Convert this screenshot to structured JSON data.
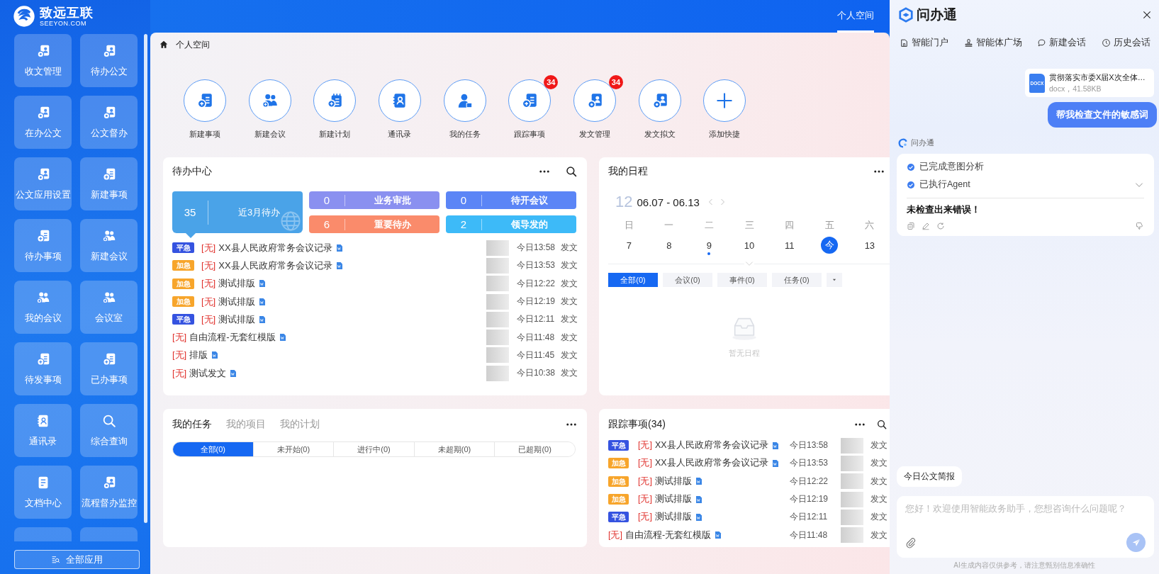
{
  "logo": {
    "name": "致远互联",
    "domain": "SEEYON.COM"
  },
  "sidebar": {
    "items": [
      {
        "kind": "app",
        "label": "收文管理"
      },
      {
        "kind": "app",
        "label": "待办公文"
      },
      {
        "kind": "app",
        "label": "在办公文"
      },
      {
        "kind": "app",
        "label": "公文督办"
      },
      {
        "kind": "app",
        "label": "公文应用设置"
      },
      {
        "kind": "app",
        "label": "新建事项"
      },
      {
        "kind": "app",
        "label": "待办事项"
      },
      {
        "kind": "app",
        "label": "新建会议"
      },
      {
        "kind": "app",
        "label": "我的会议"
      },
      {
        "kind": "app",
        "label": "会议室"
      },
      {
        "kind": "app",
        "label": "待发事项"
      },
      {
        "kind": "app",
        "label": "已办事项"
      },
      {
        "kind": "app",
        "label": "通讯录"
      },
      {
        "kind": "app",
        "label": "综合查询"
      },
      {
        "kind": "app",
        "label": "文档中心"
      },
      {
        "kind": "app",
        "label": "流程督办监控"
      },
      {
        "kind": "partial"
      },
      {
        "kind": "partial"
      }
    ],
    "all_apps_button": "全部应用"
  },
  "top_tabs": [
    {
      "label": "个人空间",
      "selected": true
    }
  ],
  "breadcrumb": "个人空间",
  "quick_actions": [
    {
      "label": "新建事项"
    },
    {
      "label": "新建会议"
    },
    {
      "label": "新建计划"
    },
    {
      "label": "通讯录"
    },
    {
      "label": "我的任务"
    },
    {
      "label": "跟踪事项",
      "badge": "34"
    },
    {
      "label": "发文管理",
      "badge": "34"
    },
    {
      "label": "发文拟文"
    },
    {
      "label": "添加快捷"
    }
  ],
  "todo": {
    "title": "待办中心",
    "stats": [
      {
        "count": "35",
        "label": "近3月待办",
        "color": "#4aa3e8"
      },
      {
        "count": "0",
        "label": "业务审批",
        "color": "#8a90f0"
      },
      {
        "count": "0",
        "label": "待开会议",
        "color": "#5b85f6"
      },
      {
        "count": "6",
        "label": "重要待办",
        "color": "#fa8b6b"
      },
      {
        "count": "2",
        "label": "领导发的",
        "color": "#3dbaf8"
      }
    ],
    "rows": [
      {
        "priority": {
          "label": "平急",
          "color": "#3553e0"
        },
        "tag": "[无]",
        "title": "XX县人民政府常务会议记录",
        "time": "今日13:58",
        "category": "发文"
      },
      {
        "priority": {
          "label": "加急",
          "color": "#f7a52b"
        },
        "tag": "[无]",
        "title": "XX县人民政府常务会议记录",
        "time": "今日13:53",
        "category": "发文"
      },
      {
        "priority": {
          "label": "加急",
          "color": "#f7a52b"
        },
        "tag": "[无]",
        "title": "测试排版",
        "time": "今日12:22",
        "category": "发文"
      },
      {
        "priority": {
          "label": "加急",
          "color": "#f7a52b"
        },
        "tag": "[无]",
        "title": "测试排版",
        "time": "今日12:19",
        "category": "发文"
      },
      {
        "priority": {
          "label": "平急",
          "color": "#3553e0"
        },
        "tag": "[无]",
        "title": "测试排版",
        "time": "今日12:11",
        "category": "发文"
      },
      {
        "tag": "[无]",
        "title": "自由流程-无套红模版",
        "time": "今日11:48",
        "category": "发文"
      },
      {
        "tag": "[无]",
        "title": "排版",
        "time": "今日11:45",
        "category": "发文"
      },
      {
        "tag": "[无]",
        "title": "测试发文",
        "time": "今日10:38",
        "category": "发文"
      }
    ]
  },
  "schedule": {
    "title": "我的日程",
    "week_number": "12",
    "range": "06.07 - 06.13",
    "weekdays": [
      "日",
      "一",
      "二",
      "三",
      "四",
      "五",
      "六"
    ],
    "days": [
      {
        "label": "7",
        "selected": false,
        "has_event": false
      },
      {
        "label": "8",
        "selected": false,
        "has_event": false
      },
      {
        "label": "9",
        "selected": false,
        "has_event": true
      },
      {
        "label": "10",
        "selected": false,
        "has_event": false
      },
      {
        "label": "11",
        "selected": false,
        "has_event": false
      },
      {
        "label": "今",
        "selected": true,
        "has_event": false
      },
      {
        "label": "13",
        "selected": false,
        "has_event": false
      }
    ],
    "filters": [
      {
        "label": "全部(0)",
        "selected": true
      },
      {
        "label": "会议(0)",
        "selected": false
      },
      {
        "label": "事件(0)",
        "selected": false
      },
      {
        "label": "任务(0)",
        "selected": false
      }
    ],
    "empty_text": "暂无日程"
  },
  "tasks": {
    "tabs": [
      {
        "label": "我的任务",
        "selected": true
      },
      {
        "label": "我的项目",
        "selected": false
      },
      {
        "label": "我的计划",
        "selected": false
      }
    ],
    "filters": [
      {
        "label": "全部(0)",
        "selected": true
      },
      {
        "label": "未开始(0)",
        "selected": false
      },
      {
        "label": "进行中(0)",
        "selected": false
      },
      {
        "label": "未超期(0)",
        "selected": false
      },
      {
        "label": "已超期(0)",
        "selected": false
      }
    ]
  },
  "tracking": {
    "title": "跟踪事项(34)",
    "rows": [
      {
        "priority": {
          "label": "平急",
          "color": "#3553e0"
        },
        "tag": "[无]",
        "title": "XX县人民政府常务会议记录",
        "time": "今日13:58",
        "category": "发文"
      },
      {
        "priority": {
          "label": "加急",
          "color": "#f7a52b"
        },
        "tag": "[无]",
        "title": "XX县人民政府常务会议记录",
        "time": "今日13:53",
        "category": "发文"
      },
      {
        "priority": {
          "label": "加急",
          "color": "#f7a52b"
        },
        "tag": "[无]",
        "title": "测试排版",
        "time": "今日12:22",
        "category": "发文"
      },
      {
        "priority": {
          "label": "加急",
          "color": "#f7a52b"
        },
        "tag": "[无]",
        "title": "测试排版",
        "time": "今日12:19",
        "category": "发文"
      },
      {
        "priority": {
          "label": "平急",
          "color": "#3553e0"
        },
        "tag": "[无]",
        "title": "测试排版",
        "time": "今日12:11",
        "category": "发文"
      },
      {
        "tag": "[无]",
        "title": "自由流程-无套红模版",
        "time": "今日11:48",
        "category": "发文"
      }
    ]
  },
  "assistant": {
    "title": "问办通",
    "nav": [
      {
        "label": "智能门户"
      },
      {
        "label": "智能体广场"
      },
      {
        "label": "新建会话"
      },
      {
        "label": "历史会话"
      }
    ],
    "file": {
      "type": "DOCX",
      "name": "贯彻落实市委X届X次全体…",
      "meta": "docx，41.58KB"
    },
    "user_message": "帮我检查文件的敏感词",
    "bot_name": "问办通",
    "steps": [
      {
        "label": "已完成意图分析",
        "done": true
      },
      {
        "label": "已执行Agent",
        "done": true
      }
    ],
    "answer": "未检查出来错误！",
    "suggestion": "今日公文简报",
    "input": {
      "placeholder": "您好！欢迎使用智能政务助手，您想咨询什么问题呢？"
    },
    "disclaimer": "AI生成内容仅供参考，请注意甄别信息准确性"
  }
}
